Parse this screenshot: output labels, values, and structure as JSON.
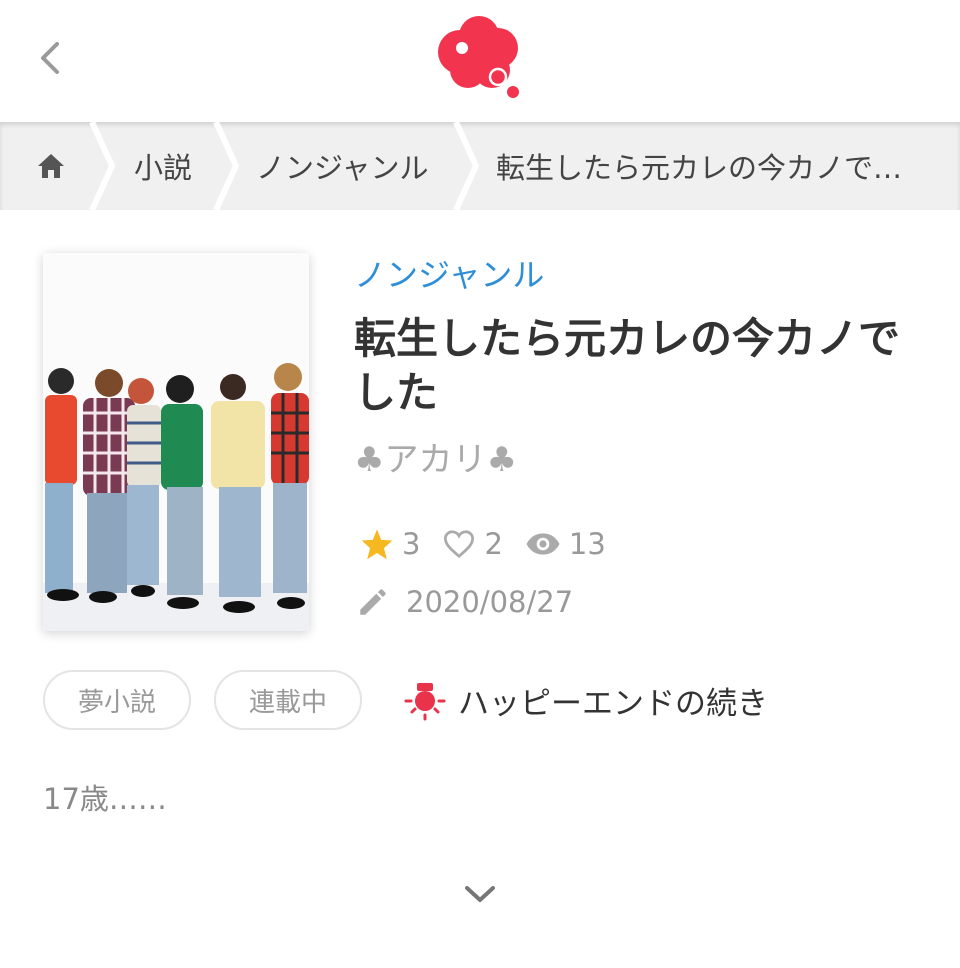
{
  "header": {
    "back_icon": "chevron-left-icon",
    "logo_icon": "speech-cloud-logo",
    "brand_color": "#f2344f"
  },
  "breadcrumb": {
    "home_icon": "home-icon",
    "items": [
      {
        "label": "小説"
      },
      {
        "label": "ノンジャンル"
      },
      {
        "label": "転生したら元カレの今カノで…"
      }
    ]
  },
  "book": {
    "genre": "ノンジャンル",
    "title": "転生したら元カレの今カノでした",
    "author": "♣アカリ♣",
    "stars": "3",
    "likes": "2",
    "views": "13",
    "updated": "2020/08/27",
    "tags": [
      "夢小説",
      "連載中"
    ],
    "ending": "ハッピーエンドの続き",
    "summary": "17歳……"
  },
  "colors": {
    "genre": "#2e8fd8",
    "star": "#f5b820",
    "ending_icon": "#e8334a"
  }
}
